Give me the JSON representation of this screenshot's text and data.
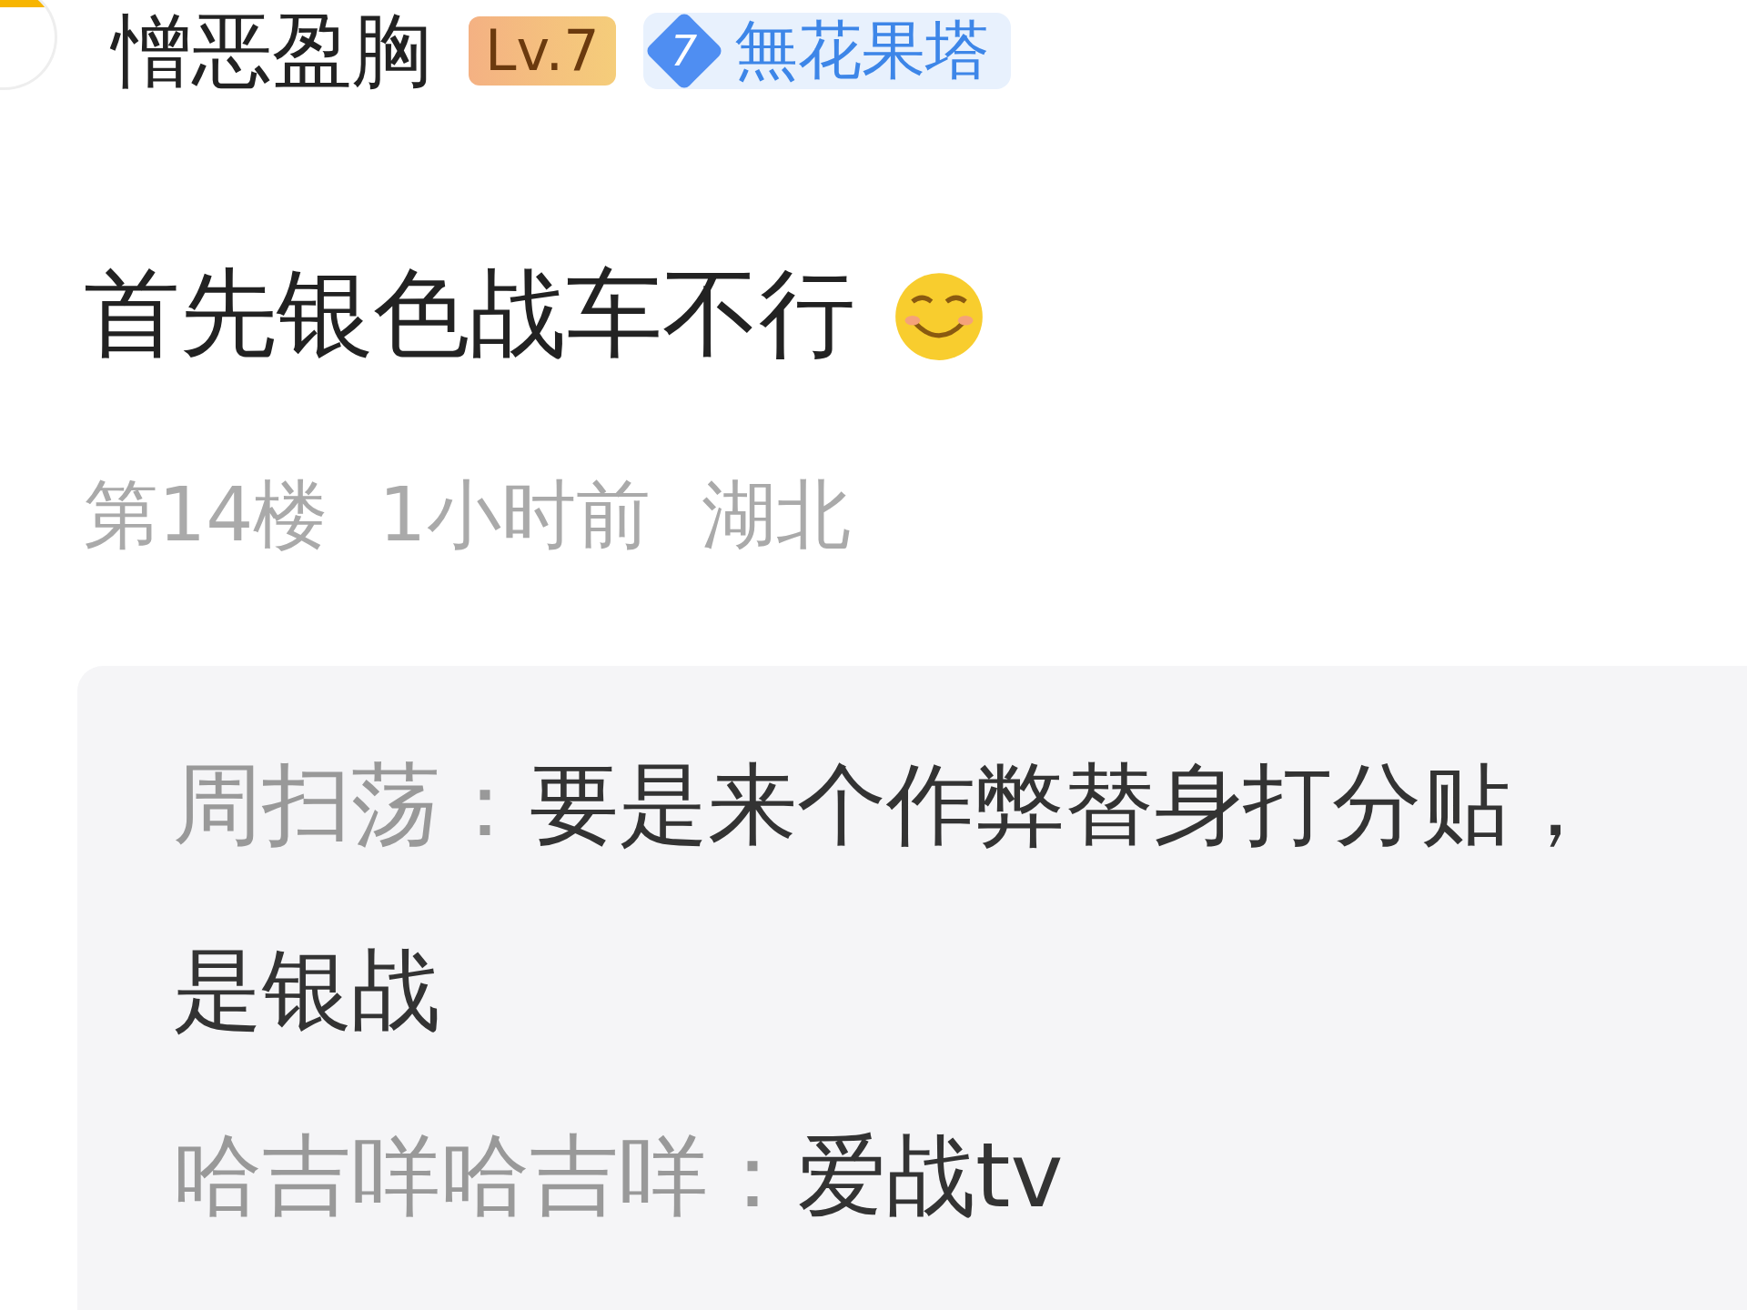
{
  "author": {
    "name": "憎恶盈胸",
    "level": "Lv.7",
    "fan_badge": {
      "number": "7",
      "name": "無花果塔"
    }
  },
  "comment": {
    "text": "首先银色战车不行"
  },
  "meta": [
    "第14楼",
    "1小时前",
    "湖北"
  ],
  "replies": [
    {
      "user": "周扫荡：",
      "text": "要是来个作弊替身打分贴，是银战"
    },
    {
      "user": "哈吉咩哈吉咩：",
      "text": "爱战tv"
    }
  ]
}
